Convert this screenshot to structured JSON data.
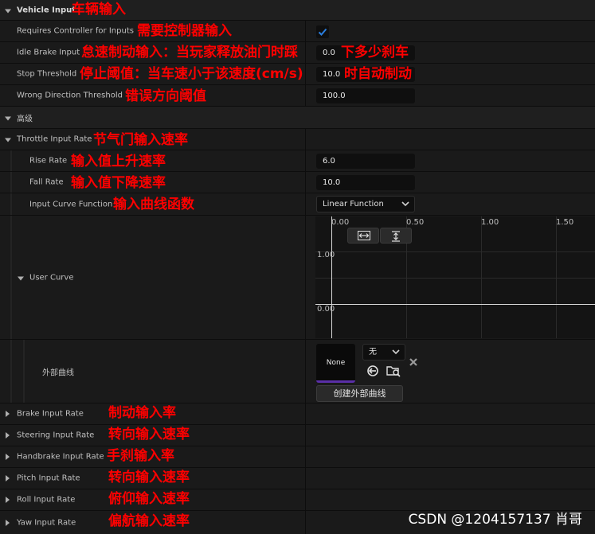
{
  "sections": {
    "vehicle_input": "Vehicle Input",
    "advanced": "高级",
    "throttle_input_rate": "Throttle Input Rate"
  },
  "props": {
    "requires_controller": "Requires Controller for Inputs",
    "idle_brake": "Idle Brake Input",
    "stop_threshold": "Stop Threshold",
    "wrong_direction": "Wrong Direction Threshold",
    "rise_rate": "Rise Rate",
    "fall_rate": "Fall Rate",
    "input_curve_function": "Input Curve Function",
    "user_curve": "User Curve",
    "external_curve": "外部曲线",
    "brake_input_rate": "Brake Input Rate",
    "steering_input_rate": "Steering Input Rate",
    "handbrake_input_rate": "Handbrake Input Rate",
    "pitch_input_rate": "Pitch Input Rate",
    "roll_input_rate": "Roll Input Rate",
    "yaw_input_rate": "Yaw Input Rate"
  },
  "values": {
    "requires_controller_checked": true,
    "idle_brake": "0.0",
    "stop_threshold": "10.0",
    "wrong_direction": "100.0",
    "rise_rate": "6.0",
    "fall_rate": "10.0",
    "input_curve_function": "Linear Function"
  },
  "curve": {
    "x_ticks": [
      "0.00",
      "0.50",
      "1.00",
      "1.50"
    ],
    "y_ticks": [
      "1.00",
      "0.00"
    ],
    "fit_horizontal_icon": "fit-horizontal-icon",
    "fit_vertical_icon": "fit-vertical-icon"
  },
  "external_curve": {
    "thumbnail_label": "None",
    "dropdown_value": "无",
    "create_button": "创建外部曲线",
    "icons": [
      "browse-back-icon",
      "browse-folder-icon",
      "clear-x-icon"
    ]
  },
  "annotations": {
    "vehicle_input": "车辆输入",
    "requires_controller": "需要控制器输入",
    "idle_brake_a": "怠速制动输入：当玩家释放油门时踩",
    "idle_brake_b": "下多少刹车",
    "stop_threshold_a": "停止阈值：当车速小于该速度(cm/s)",
    "stop_threshold_b": "时自动制动",
    "wrong_direction": "错误方向阈值",
    "throttle_input_rate": "节气门输入速率",
    "rise_rate": "输入值上升速率",
    "fall_rate": "输入值下降速率",
    "input_curve_function": "输入曲线函数",
    "brake_input_rate": "制动输入率",
    "steering_input_rate": "转向输入速率",
    "handbrake_input_rate": "手刹输入率",
    "pitch_input_rate": "转向输入速率",
    "roll_input_rate": "俯仰输入速率",
    "yaw_input_rate": "偏航输入速率"
  },
  "watermark": "CSDN @1204157137 肖哥",
  "colors": {
    "annotation": "#ff0000",
    "checkbox_check": "#2a7fe0",
    "thumbnail_accent": "#5a2fa8"
  }
}
